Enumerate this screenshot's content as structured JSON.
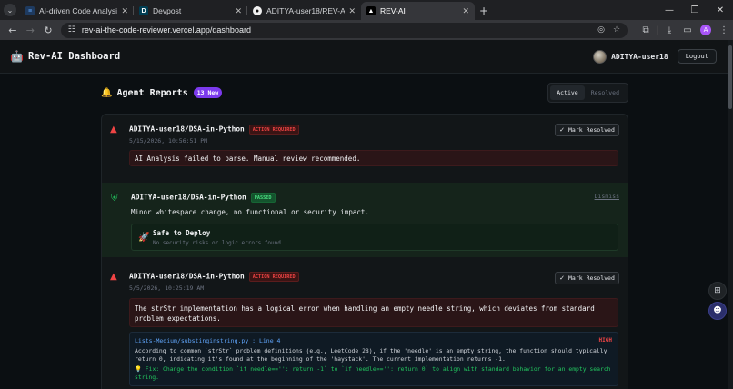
{
  "browser": {
    "tabs": [
      {
        "title": "AI-driven Code Analysis",
        "fav": "≡",
        "fav_color": "#3b82f6",
        "fav_bg": "#1e3a5f",
        "active": false
      },
      {
        "title": "Devpost",
        "fav": "D",
        "fav_color": "#ffffff",
        "fav_bg": "#003e54",
        "active": false
      },
      {
        "title": "ADITYA-user18/REV-AI-----The-...",
        "fav": "●",
        "fav_color": "#ffffff",
        "fav_bg": "#24292f",
        "active": false
      },
      {
        "title": "REV-AI",
        "fav": "▲",
        "fav_color": "#ffffff",
        "fav_bg": "#000000",
        "active": true
      }
    ],
    "url": "rev-ai-the-code-reviewer.vercel.app/dashboard",
    "profile_initial": "A"
  },
  "header": {
    "title": "Rev-AI Dashboard",
    "username": "ADITYA-user18",
    "logout_label": "Logout"
  },
  "reports": {
    "title": "Agent Reports",
    "new_badge": "13 New",
    "filter_active": "Active",
    "filter_resolved": "Resolved",
    "items": [
      {
        "repo": "ADITYA-user18/DSA-in-Python",
        "badge": "ACTION REQUIRED",
        "time": "5/15/2026, 10:56:51 PM",
        "action": "Mark Resolved",
        "message": "AI Analysis failed to parse. Manual review recommended."
      },
      {
        "repo": "ADITYA-user18/DSA-in-Python",
        "badge": "PASSED",
        "dismiss": "Dismiss",
        "summary": "Minor whitespace change, no functional or security impact.",
        "deploy_title": "Safe to Deploy",
        "deploy_sub": "No security risks or logic errors found."
      },
      {
        "repo": "ADITYA-user18/DSA-in-Python",
        "badge": "ACTION REQUIRED",
        "time": "5/5/2026, 10:25:19 AM",
        "action": "Mark Resolved",
        "message": "The strStr implementation has a logical error when handling an empty needle string, which deviates from standard problem expectations.",
        "issue": {
          "file": "Lists-Medium/substinginstring.py : Line 4",
          "severity": "HIGH",
          "description": "According to common `strStr` problem definitions (e.g., LeetCode 28), if the 'needle' is an empty string, the function should typically return 0, indicating it's found at the beginning of the 'haystack'. The current implementation returns -1.",
          "fix": "💡 Fix: Change the condition `if needle=='': return -1` to `if needle=='': return 0` to align with standard behavior for an empty search string."
        }
      }
    ]
  },
  "colors": {
    "accent": "#8b5cf6",
    "danger": "#ef4444",
    "success": "#22c55e",
    "background": "#0b0f12"
  }
}
